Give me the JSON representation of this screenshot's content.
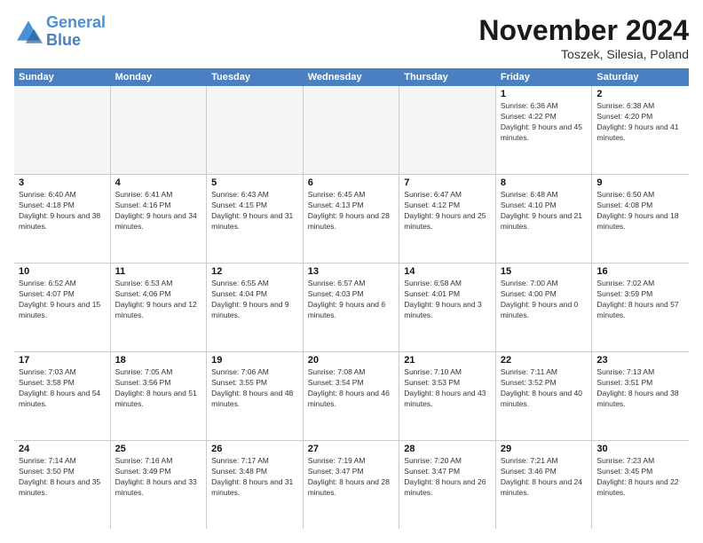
{
  "header": {
    "logo_general": "General",
    "logo_blue": "Blue",
    "month_title": "November 2024",
    "location": "Toszek, Silesia, Poland"
  },
  "days_of_week": [
    "Sunday",
    "Monday",
    "Tuesday",
    "Wednesday",
    "Thursday",
    "Friday",
    "Saturday"
  ],
  "rows": [
    [
      {
        "day": "",
        "info": "",
        "empty": true
      },
      {
        "day": "",
        "info": "",
        "empty": true
      },
      {
        "day": "",
        "info": "",
        "empty": true
      },
      {
        "day": "",
        "info": "",
        "empty": true
      },
      {
        "day": "",
        "info": "",
        "empty": true
      },
      {
        "day": "1",
        "info": "Sunrise: 6:36 AM\nSunset: 4:22 PM\nDaylight: 9 hours and 45 minutes.",
        "empty": false
      },
      {
        "day": "2",
        "info": "Sunrise: 6:38 AM\nSunset: 4:20 PM\nDaylight: 9 hours and 41 minutes.",
        "empty": false
      }
    ],
    [
      {
        "day": "3",
        "info": "Sunrise: 6:40 AM\nSunset: 4:18 PM\nDaylight: 9 hours and 38 minutes.",
        "empty": false
      },
      {
        "day": "4",
        "info": "Sunrise: 6:41 AM\nSunset: 4:16 PM\nDaylight: 9 hours and 34 minutes.",
        "empty": false
      },
      {
        "day": "5",
        "info": "Sunrise: 6:43 AM\nSunset: 4:15 PM\nDaylight: 9 hours and 31 minutes.",
        "empty": false
      },
      {
        "day": "6",
        "info": "Sunrise: 6:45 AM\nSunset: 4:13 PM\nDaylight: 9 hours and 28 minutes.",
        "empty": false
      },
      {
        "day": "7",
        "info": "Sunrise: 6:47 AM\nSunset: 4:12 PM\nDaylight: 9 hours and 25 minutes.",
        "empty": false
      },
      {
        "day": "8",
        "info": "Sunrise: 6:48 AM\nSunset: 4:10 PM\nDaylight: 9 hours and 21 minutes.",
        "empty": false
      },
      {
        "day": "9",
        "info": "Sunrise: 6:50 AM\nSunset: 4:08 PM\nDaylight: 9 hours and 18 minutes.",
        "empty": false
      }
    ],
    [
      {
        "day": "10",
        "info": "Sunrise: 6:52 AM\nSunset: 4:07 PM\nDaylight: 9 hours and 15 minutes.",
        "empty": false
      },
      {
        "day": "11",
        "info": "Sunrise: 6:53 AM\nSunset: 4:06 PM\nDaylight: 9 hours and 12 minutes.",
        "empty": false
      },
      {
        "day": "12",
        "info": "Sunrise: 6:55 AM\nSunset: 4:04 PM\nDaylight: 9 hours and 9 minutes.",
        "empty": false
      },
      {
        "day": "13",
        "info": "Sunrise: 6:57 AM\nSunset: 4:03 PM\nDaylight: 9 hours and 6 minutes.",
        "empty": false
      },
      {
        "day": "14",
        "info": "Sunrise: 6:58 AM\nSunset: 4:01 PM\nDaylight: 9 hours and 3 minutes.",
        "empty": false
      },
      {
        "day": "15",
        "info": "Sunrise: 7:00 AM\nSunset: 4:00 PM\nDaylight: 9 hours and 0 minutes.",
        "empty": false
      },
      {
        "day": "16",
        "info": "Sunrise: 7:02 AM\nSunset: 3:59 PM\nDaylight: 8 hours and 57 minutes.",
        "empty": false
      }
    ],
    [
      {
        "day": "17",
        "info": "Sunrise: 7:03 AM\nSunset: 3:58 PM\nDaylight: 8 hours and 54 minutes.",
        "empty": false
      },
      {
        "day": "18",
        "info": "Sunrise: 7:05 AM\nSunset: 3:56 PM\nDaylight: 8 hours and 51 minutes.",
        "empty": false
      },
      {
        "day": "19",
        "info": "Sunrise: 7:06 AM\nSunset: 3:55 PM\nDaylight: 8 hours and 48 minutes.",
        "empty": false
      },
      {
        "day": "20",
        "info": "Sunrise: 7:08 AM\nSunset: 3:54 PM\nDaylight: 8 hours and 46 minutes.",
        "empty": false
      },
      {
        "day": "21",
        "info": "Sunrise: 7:10 AM\nSunset: 3:53 PM\nDaylight: 8 hours and 43 minutes.",
        "empty": false
      },
      {
        "day": "22",
        "info": "Sunrise: 7:11 AM\nSunset: 3:52 PM\nDaylight: 8 hours and 40 minutes.",
        "empty": false
      },
      {
        "day": "23",
        "info": "Sunrise: 7:13 AM\nSunset: 3:51 PM\nDaylight: 8 hours and 38 minutes.",
        "empty": false
      }
    ],
    [
      {
        "day": "24",
        "info": "Sunrise: 7:14 AM\nSunset: 3:50 PM\nDaylight: 8 hours and 35 minutes.",
        "empty": false
      },
      {
        "day": "25",
        "info": "Sunrise: 7:16 AM\nSunset: 3:49 PM\nDaylight: 8 hours and 33 minutes.",
        "empty": false
      },
      {
        "day": "26",
        "info": "Sunrise: 7:17 AM\nSunset: 3:48 PM\nDaylight: 8 hours and 31 minutes.",
        "empty": false
      },
      {
        "day": "27",
        "info": "Sunrise: 7:19 AM\nSunset: 3:47 PM\nDaylight: 8 hours and 28 minutes.",
        "empty": false
      },
      {
        "day": "28",
        "info": "Sunrise: 7:20 AM\nSunset: 3:47 PM\nDaylight: 8 hours and 26 minutes.",
        "empty": false
      },
      {
        "day": "29",
        "info": "Sunrise: 7:21 AM\nSunset: 3:46 PM\nDaylight: 8 hours and 24 minutes.",
        "empty": false
      },
      {
        "day": "30",
        "info": "Sunrise: 7:23 AM\nSunset: 3:45 PM\nDaylight: 8 hours and 22 minutes.",
        "empty": false
      }
    ]
  ]
}
